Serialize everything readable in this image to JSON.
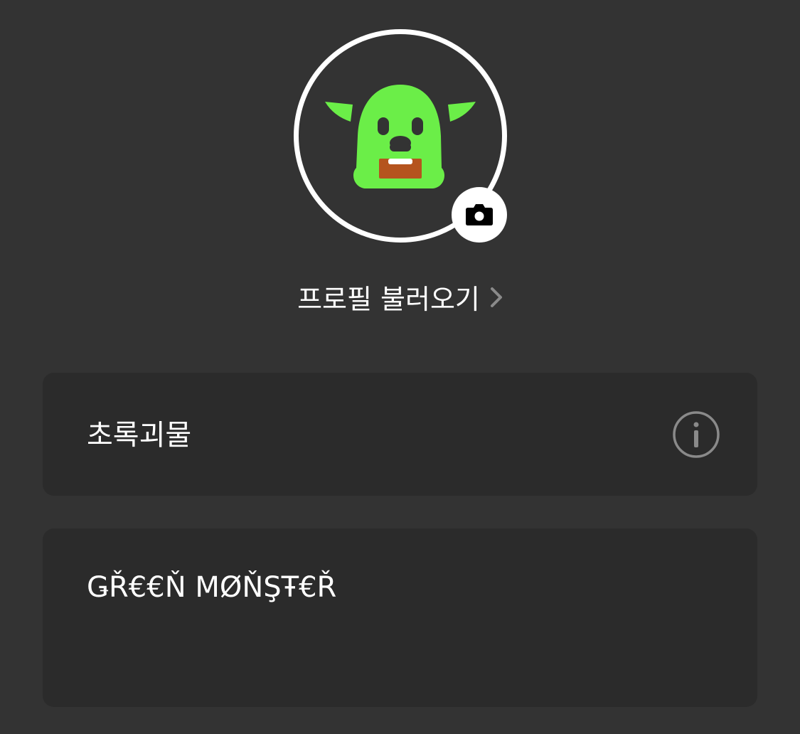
{
  "profile": {
    "avatar_icon": "green-monster-avatar",
    "camera_icon": "camera-icon",
    "load_profile_label": "프로필 불러오기",
    "chevron_icon": "chevron-right-icon"
  },
  "name_field": {
    "value": "초록괴물",
    "info_icon": "info-icon"
  },
  "status_field": {
    "value": "ǤŘ€€Ň MØŇŞŦ€Ř"
  },
  "colors": {
    "background": "#333333",
    "card": "#2b2b2b",
    "monster_green": "#6bee48",
    "monster_mouth": "#b5541e",
    "text": "#ffffff",
    "muted_icon": "#8a8a8a"
  }
}
